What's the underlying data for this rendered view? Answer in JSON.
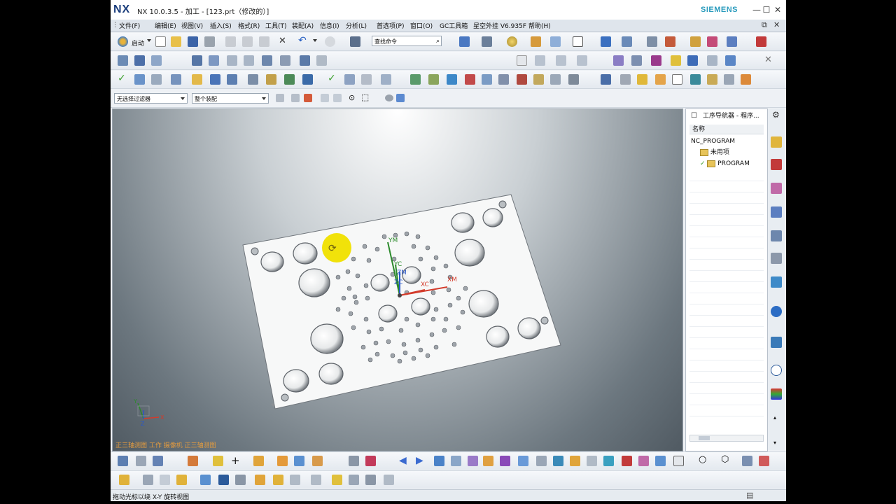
{
  "window": {
    "logo": "NX",
    "title": "NX 10.0.3.5 - 加工 - [123.prt（修改的）]",
    "brand": "SIEMENS",
    "minimize": "—",
    "maximize": "☐",
    "close": "✕"
  },
  "menu": {
    "items": [
      {
        "label": "文件(F)"
      },
      {
        "label": "编辑(E)"
      },
      {
        "label": "视图(V)"
      },
      {
        "label": "插入(S)"
      },
      {
        "label": "格式(R)"
      },
      {
        "label": "工具(T)"
      },
      {
        "label": "装配(A)"
      },
      {
        "label": "信息(I)"
      },
      {
        "label": "分析(L)"
      },
      {
        "label": "首选项(P)"
      },
      {
        "label": "窗口(O)"
      },
      {
        "label": "GC工具箱"
      },
      {
        "label": "星空外挂 V6.935F"
      },
      {
        "label": "帮助(H)"
      }
    ],
    "restore": "⧉",
    "close": "✕"
  },
  "toolbar": {
    "start_label": "启动",
    "search_placeholder": "查找命令"
  },
  "filterbar": {
    "filter_value": "无选择过滤器",
    "scope_value": "整个装配"
  },
  "viewport": {
    "status_text": "正三轴测图  工作  摄像机  正三轴测图",
    "axes": {
      "ym": "YM",
      "yc": "YC",
      "zm": "ZM",
      "zc": "ZC",
      "xc": "XC",
      "xm": "XM"
    },
    "triad": {
      "x": "X",
      "y": "Y",
      "z": "Z"
    }
  },
  "navigator": {
    "title": "工序导航器 - 程序...",
    "column": "名称",
    "rows": [
      {
        "label": "NC_PROGRAM"
      },
      {
        "label": "未用项"
      },
      {
        "label": "PROGRAM"
      }
    ]
  },
  "statusbar": {
    "text": "拖动光标以绕 X-Y 旋转视图"
  },
  "colors": {
    "accent": "#1a3d7c",
    "brand": "#2a9bbd",
    "status_orange": "#e39b3f",
    "highlight_yellow": "#f1e20a"
  }
}
